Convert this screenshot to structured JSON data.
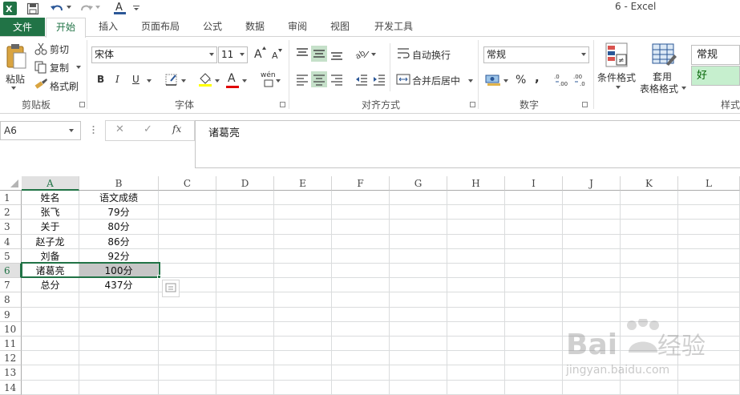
{
  "window": {
    "title": "6 - Excel"
  },
  "tabs": {
    "file": "文件",
    "items": [
      "开始",
      "插入",
      "页面布局",
      "公式",
      "数据",
      "审阅",
      "视图",
      "开发工具"
    ]
  },
  "ribbon": {
    "clipboard": {
      "paste": "粘贴",
      "cut": "剪切",
      "copy": "复制",
      "format_painter": "格式刷",
      "label": "剪贴板"
    },
    "font": {
      "name": "宋体",
      "size": "11",
      "bold": "B",
      "italic": "I",
      "underline": "U",
      "label": "字体",
      "grow": "A",
      "shrink": "A",
      "font_color_letter": "A",
      "phonetic": "wén"
    },
    "alignment": {
      "wrap_text": "自动换行",
      "merge_center": "合并后居中",
      "label": "对齐方式"
    },
    "number": {
      "format": "常规",
      "percent": "%",
      "comma": ",",
      "label": "数字"
    },
    "styles": {
      "conditional": "条件格式",
      "table_format": "套用\n表格格式",
      "style_normal": "常规",
      "style_good": "好",
      "label": "样式"
    }
  },
  "formula_bar": {
    "name_box": "A6",
    "cancel": "✕",
    "enter": "✓",
    "fx": "fx",
    "content": "诸葛亮"
  },
  "sheet": {
    "columns": [
      "A",
      "B",
      "C",
      "D",
      "E",
      "F",
      "G",
      "H",
      "I",
      "J",
      "K",
      "L"
    ],
    "rows": [
      "1",
      "2",
      "3",
      "4",
      "5",
      "6",
      "7",
      "8",
      "9",
      "10",
      "11",
      "12",
      "13",
      "14"
    ],
    "data": [
      [
        "姓名",
        "语文成绩"
      ],
      [
        "张飞",
        "79分"
      ],
      [
        "关于",
        "80分"
      ],
      [
        "赵子龙",
        "86分"
      ],
      [
        "刘备",
        "92分"
      ],
      [
        "诸葛亮",
        "100分"
      ],
      [
        "总分",
        "437分"
      ]
    ],
    "selected_cell": "A6"
  },
  "watermark": {
    "brand": "Baidu经验",
    "url": "jingyan.baidu.com"
  },
  "colors": {
    "accent": "#217346",
    "selection_shade": "#c6c6c6",
    "good_style": "#c6efce"
  }
}
